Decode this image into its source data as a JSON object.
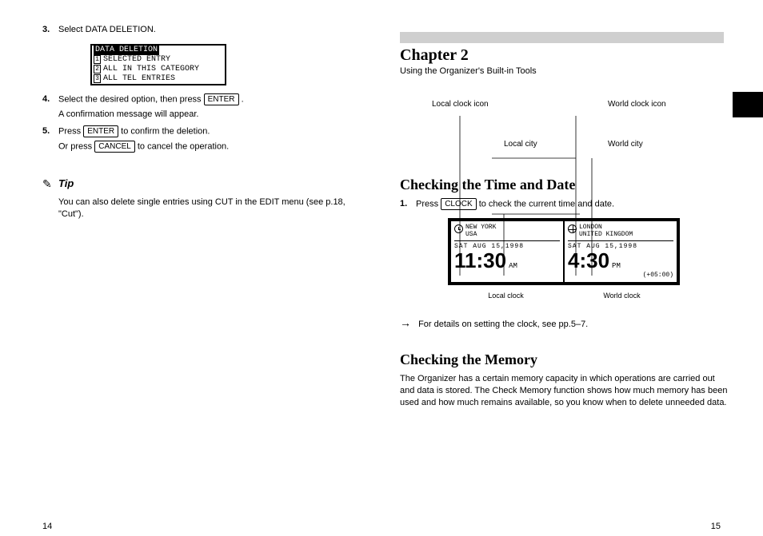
{
  "pages": {
    "left": "14",
    "right": "15"
  },
  "left": {
    "deleteMenu": {
      "title": "DATA DELETION",
      "items": [
        "SELECTED ENTRY",
        "ALL IN THIS CATEGORY",
        "ALL TEL ENTRIES"
      ]
    },
    "step3": {
      "num": "3.",
      "text": "Select DATA DELETION."
    },
    "step4": {
      "num": "4.",
      "text_a": "Select the desired option, then press ",
      "key": "ENTER",
      "text_b": "."
    },
    "step4_sub": "A confirmation message will appear.",
    "step5": {
      "num": "5.",
      "text_a": "Press ",
      "key": "ENTER",
      "text_b": " to confirm the deletion.",
      "sub_a": "Or press ",
      "key2": "CANCEL",
      "sub_b": " to cancel the operation."
    },
    "tipLabel": "Tip",
    "tipText": "You can also delete single entries using CUT in the EDIT menu (see p.18, \"Cut\")."
  },
  "right": {
    "chapter": "Chapter 2",
    "chapterSub": "Using the Organizer's Built-in Tools",
    "sec1": "Checking the Time and Date",
    "callouts": {
      "worldIcon": "World clock icon",
      "localIcon": "Local clock icon",
      "worldCity": "World city",
      "localCity": "Local city"
    },
    "clock": {
      "left": {
        "city": "NEW YORK",
        "country": "USA",
        "date": "SAT AUG 15,1998",
        "time": "11:30",
        "ampm": "AM"
      },
      "right": {
        "city": "LONDON",
        "country": "UNITED KINGDOM",
        "date": "SAT AUG 15,1998",
        "time": "4:30",
        "ampm": "PM",
        "offset": "(+05:00)"
      }
    },
    "captionLeft": "Local clock",
    "captionRight": "World clock",
    "clockStep": {
      "num": "1.",
      "text_a": "Press ",
      "key": "CLOCK",
      "text_b": " to check the current time and date."
    },
    "clockNote": "  For details on setting the clock, see pp.5–7.",
    "sec2": "Checking the Memory",
    "memBody": "The Organizer has a certain memory capacity in which operations are carried out and data is stored. The Check Memory function shows how much memory has been used and how much remains available, so you know when to delete unneeded data."
  },
  "icons": {
    "tip": "✎"
  }
}
